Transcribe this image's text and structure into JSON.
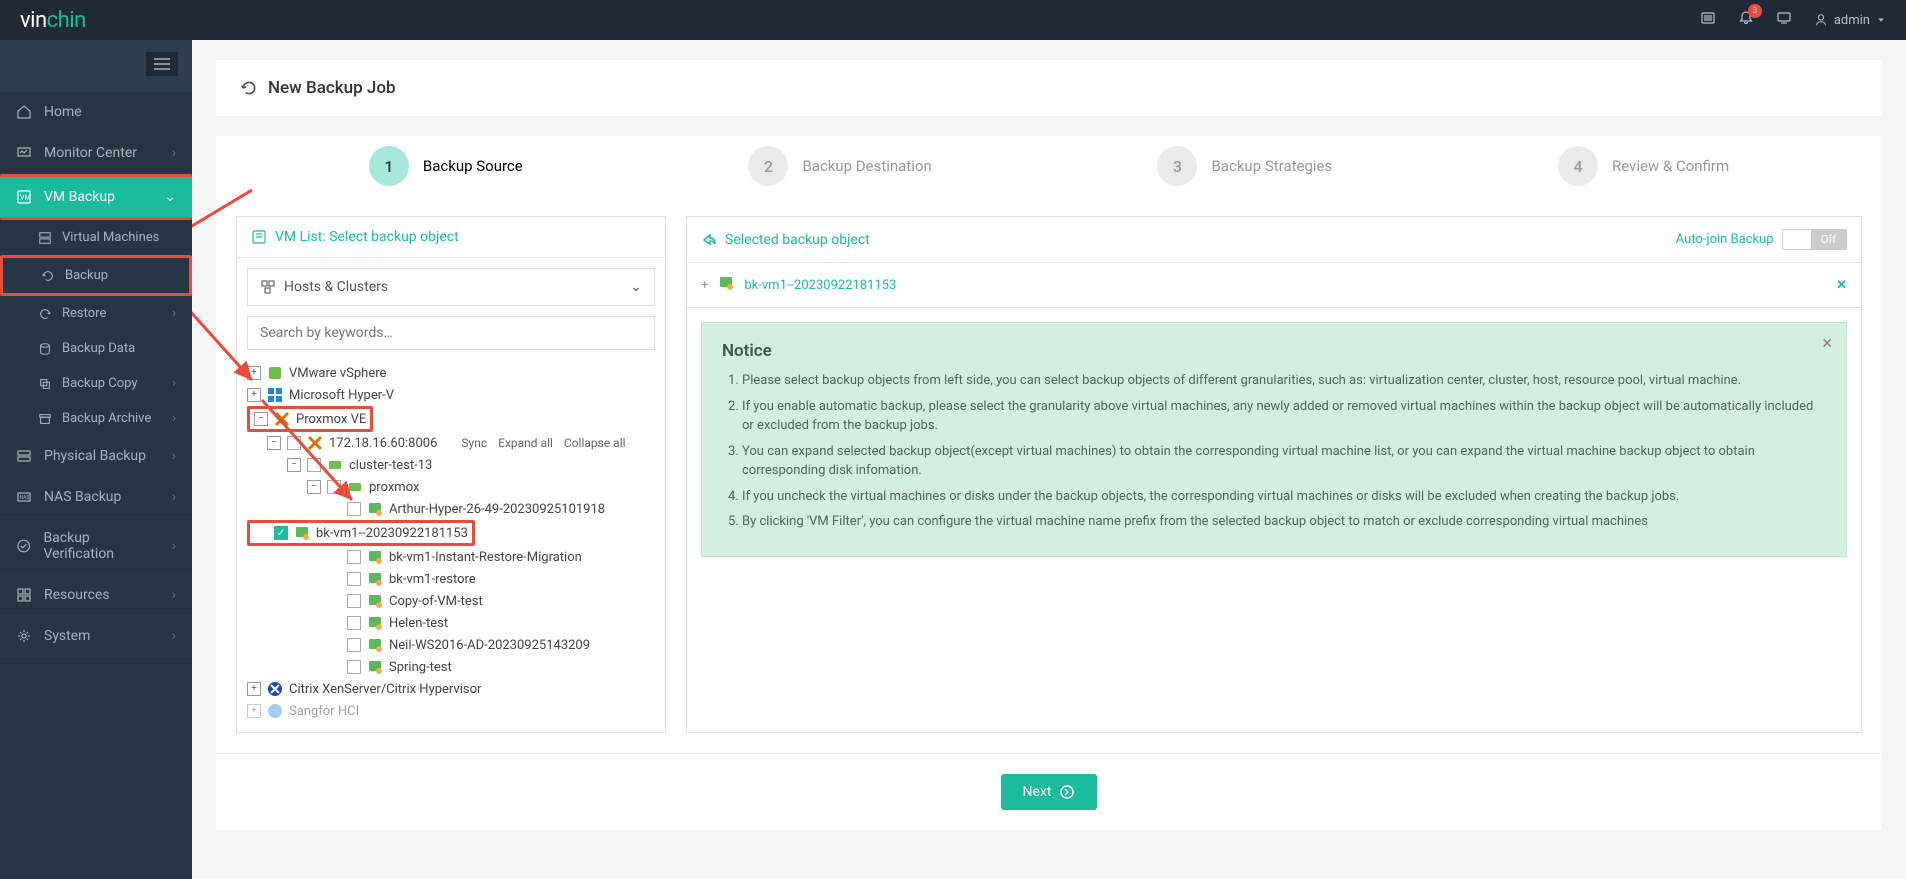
{
  "header": {
    "logo_prefix": "vin",
    "logo_suffix": "chin",
    "notification_count": "3",
    "user_label": "admin"
  },
  "sidebar": {
    "items": [
      {
        "label": "Home"
      },
      {
        "label": "Monitor Center"
      },
      {
        "label": "VM Backup"
      },
      {
        "label": "Physical Backup"
      },
      {
        "label": "NAS Backup"
      },
      {
        "label": "Backup Verification"
      },
      {
        "label": "Resources"
      },
      {
        "label": "System"
      }
    ],
    "vm_sub": [
      {
        "label": "Virtual Machines"
      },
      {
        "label": "Backup"
      },
      {
        "label": "Restore"
      },
      {
        "label": "Backup Data"
      },
      {
        "label": "Backup Copy"
      },
      {
        "label": "Backup Archive"
      }
    ]
  },
  "page_title": "New Backup Job",
  "wizard": [
    {
      "num": "1",
      "label": "Backup Source"
    },
    {
      "num": "2",
      "label": "Backup Destination"
    },
    {
      "num": "3",
      "label": "Backup Strategies"
    },
    {
      "num": "4",
      "label": "Review & Confirm"
    }
  ],
  "left_panel": {
    "title": "VM List: Select backup object",
    "view_select": "Hosts & Clusters",
    "search_placeholder": "Search by keywords…",
    "tree": {
      "vmware": "VMware vSphere",
      "hyperv": "Microsoft Hyper-V",
      "proxmox": "Proxmox VE",
      "host": "172.18.16.60:8006",
      "actions": {
        "sync": "Sync",
        "expand": "Expand all",
        "collapse": "Collapse all"
      },
      "cluster": "cluster-test-13",
      "node": "proxmox",
      "vms": [
        "Arthur-Hyper-26-49-20230925101918",
        "bk-vm1--20230922181153",
        "bk-vm1-Instant-Restore-Migration",
        "bk-vm1-restore",
        "Copy-of-VM-test",
        "Helen-test",
        "Neil-WS2016-AD-20230925143209",
        "Spring-test"
      ],
      "xen": "Citrix XenServer/Citrix Hypervisor",
      "sangfor": "Sangfor HCI"
    }
  },
  "right_panel": {
    "title": "Selected backup object",
    "auto_join_label": "Auto-join Backup",
    "toggle_off": "Off",
    "selected_vm": "bk-vm1--20230922181153",
    "notice": {
      "title": "Notice",
      "items": [
        "Please select backup objects from left side, you can select backup objects of different granularities, such as: virtualization center, cluster, host, resource pool, virtual machine.",
        "If you enable automatic backup, please select the granularity above virtual machines, any newly added or removed virtual machines within the backup object will be automatically included or excluded from the backup jobs.",
        "You can expand selected backup object(except virtual machines) to obtain the corresponding virtual machine list, or you can expand the virtual machine backup object to obtain corresponding disk infomation.",
        "If you uncheck the virtual machines or disks under the backup objects, the corresponding virtual machines or disks will be excluded when creating the backup jobs.",
        "By clicking 'VM Filter', you can configure the virtual machine name prefix from the selected backup object to match or exclude corresponding virtual machines"
      ]
    }
  },
  "next_btn": "Next"
}
